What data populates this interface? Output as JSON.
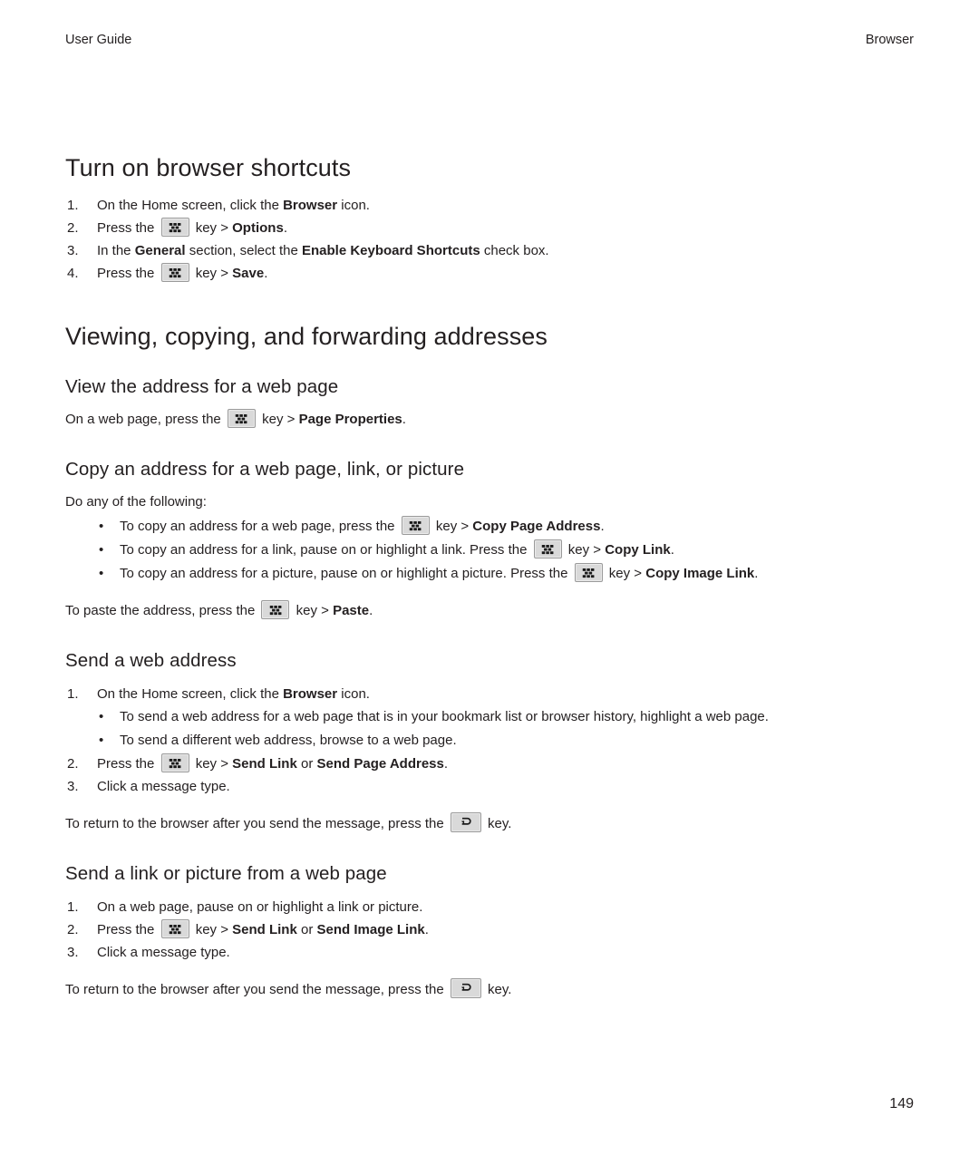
{
  "header": {
    "left": "User Guide",
    "right": "Browser"
  },
  "footer": {
    "page_number": "149"
  },
  "icons": {
    "menu_key": "blackberry-menu-key-icon",
    "escape_key": "escape-back-key-icon"
  },
  "sections": [
    {
      "id": "turn-on-browser-shortcuts",
      "heading": "Turn on browser shortcuts",
      "steps": [
        {
          "num": "1.",
          "parts": [
            {
              "t": "text",
              "v": "On the Home screen, click the "
            },
            {
              "t": "bold",
              "v": "Browser"
            },
            {
              "t": "text",
              "v": " icon."
            }
          ]
        },
        {
          "num": "2.",
          "parts": [
            {
              "t": "text",
              "v": "Press the "
            },
            {
              "t": "key",
              "v": "menu"
            },
            {
              "t": "text",
              "v": " key > "
            },
            {
              "t": "bold",
              "v": "Options"
            },
            {
              "t": "text",
              "v": "."
            }
          ]
        },
        {
          "num": "3.",
          "parts": [
            {
              "t": "text",
              "v": "In the "
            },
            {
              "t": "bold",
              "v": "General"
            },
            {
              "t": "text",
              "v": " section, select the "
            },
            {
              "t": "bold",
              "v": "Enable Keyboard Shortcuts"
            },
            {
              "t": "text",
              "v": " check box."
            }
          ]
        },
        {
          "num": "4.",
          "parts": [
            {
              "t": "text",
              "v": "Press the "
            },
            {
              "t": "key",
              "v": "menu"
            },
            {
              "t": "text",
              "v": " key > "
            },
            {
              "t": "bold",
              "v": "Save"
            },
            {
              "t": "text",
              "v": "."
            }
          ]
        }
      ]
    }
  ],
  "major_heading_2": "Viewing, copying, and forwarding addresses",
  "subsections": [
    {
      "id": "view-the-address-for-a-web-page",
      "heading": "View the address for a web page",
      "paragraph": [
        {
          "t": "text",
          "v": "On a web page, press the "
        },
        {
          "t": "key",
          "v": "menu"
        },
        {
          "t": "text",
          "v": " key > "
        },
        {
          "t": "bold",
          "v": "Page Properties"
        },
        {
          "t": "text",
          "v": "."
        }
      ]
    },
    {
      "id": "copy-an-address-for-a-web-page-link-or-picture",
      "heading": "Copy an address for a web page, link, or picture",
      "intro": "Do any of the following:",
      "bullets": [
        [
          {
            "t": "text",
            "v": "To copy an address for a web page, press the "
          },
          {
            "t": "key",
            "v": "menu"
          },
          {
            "t": "text",
            "v": " key > "
          },
          {
            "t": "bold",
            "v": "Copy Page Address"
          },
          {
            "t": "text",
            "v": "."
          }
        ],
        [
          {
            "t": "text",
            "v": "To copy an address for a link, pause on or highlight a link. Press the "
          },
          {
            "t": "key",
            "v": "menu"
          },
          {
            "t": "text",
            "v": " key > "
          },
          {
            "t": "bold",
            "v": "Copy Link"
          },
          {
            "t": "text",
            "v": "."
          }
        ],
        [
          {
            "t": "text",
            "v": "To copy an address for a picture, pause on or highlight a picture. Press the "
          },
          {
            "t": "key",
            "v": "menu"
          },
          {
            "t": "text",
            "v": " key > "
          },
          {
            "t": "bold",
            "v": "Copy Image Link"
          },
          {
            "t": "text",
            "v": "."
          }
        ]
      ],
      "outro": [
        {
          "t": "text",
          "v": "To paste the address, press the "
        },
        {
          "t": "key",
          "v": "menu"
        },
        {
          "t": "text",
          "v": " key > "
        },
        {
          "t": "bold",
          "v": "Paste"
        },
        {
          "t": "text",
          "v": "."
        }
      ]
    },
    {
      "id": "send-a-web-address",
      "heading": "Send a web address",
      "steps": [
        {
          "num": "1.",
          "parts": [
            {
              "t": "text",
              "v": "On the Home screen, click the "
            },
            {
              "t": "bold",
              "v": "Browser"
            },
            {
              "t": "text",
              "v": " icon."
            }
          ],
          "sub_bullets": [
            [
              {
                "t": "text",
                "v": "To send a web address for a web page that is in your bookmark list or browser history, highlight a web page."
              }
            ],
            [
              {
                "t": "text",
                "v": "To send a different web address, browse to a web page."
              }
            ]
          ]
        },
        {
          "num": "2.",
          "parts": [
            {
              "t": "text",
              "v": "Press the "
            },
            {
              "t": "key",
              "v": "menu"
            },
            {
              "t": "text",
              "v": " key > "
            },
            {
              "t": "bold",
              "v": "Send Link"
            },
            {
              "t": "text",
              "v": " or "
            },
            {
              "t": "bold",
              "v": "Send Page Address"
            },
            {
              "t": "text",
              "v": "."
            }
          ]
        },
        {
          "num": "3.",
          "parts": [
            {
              "t": "text",
              "v": "Click a message type."
            }
          ]
        }
      ],
      "outro": [
        {
          "t": "text",
          "v": "To return to the browser after you send the message, press the "
        },
        {
          "t": "key",
          "v": "escape"
        },
        {
          "t": "text",
          "v": " key."
        }
      ]
    },
    {
      "id": "send-a-link-or-picture-from-a-web-page",
      "heading": "Send a link or picture from a web page",
      "steps": [
        {
          "num": "1.",
          "parts": [
            {
              "t": "text",
              "v": "On a web page, pause on or highlight a link or picture."
            }
          ]
        },
        {
          "num": "2.",
          "parts": [
            {
              "t": "text",
              "v": "Press the "
            },
            {
              "t": "key",
              "v": "menu"
            },
            {
              "t": "text",
              "v": " key > "
            },
            {
              "t": "bold",
              "v": "Send Link"
            },
            {
              "t": "text",
              "v": " or "
            },
            {
              "t": "bold",
              "v": "Send Image Link"
            },
            {
              "t": "text",
              "v": "."
            }
          ]
        },
        {
          "num": "3.",
          "parts": [
            {
              "t": "text",
              "v": "Click a message type."
            }
          ]
        }
      ],
      "outro": [
        {
          "t": "text",
          "v": "To return to the browser after you send the message, press the "
        },
        {
          "t": "key",
          "v": "escape"
        },
        {
          "t": "text",
          "v": " key."
        }
      ]
    }
  ],
  "bullet_glyph": "•"
}
